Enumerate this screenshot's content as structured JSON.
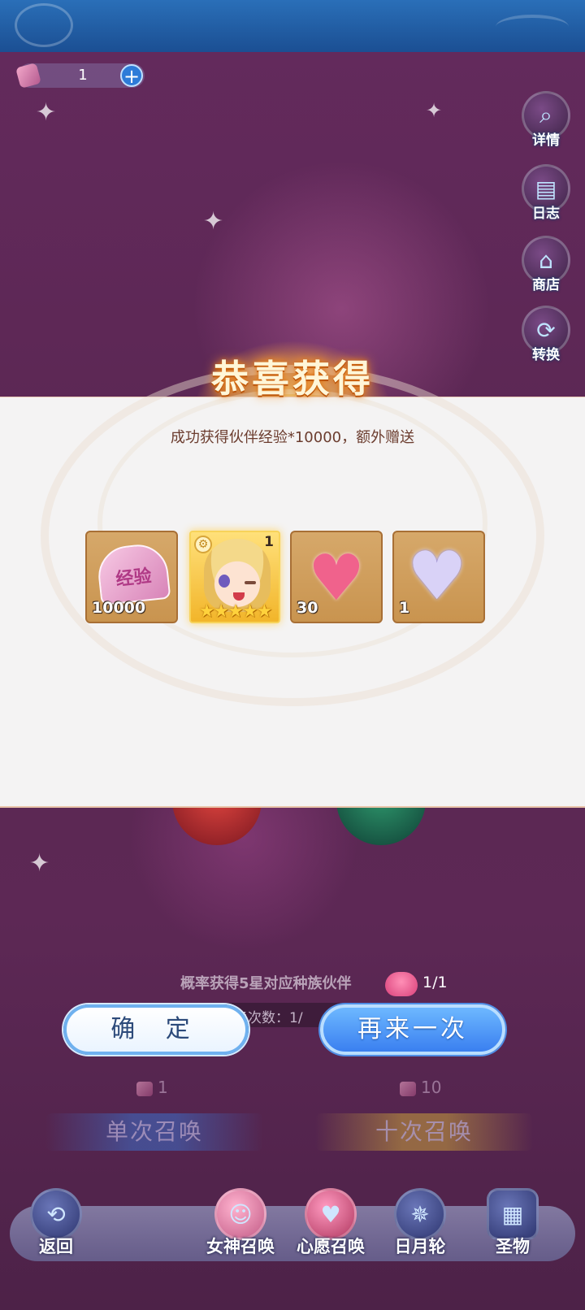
{
  "currency": {
    "value": "1",
    "plus_label": "+"
  },
  "side_menu": [
    {
      "label": "详情",
      "icon": "magnifier-icon",
      "glyph": "⌕"
    },
    {
      "label": "日志",
      "icon": "book-icon",
      "glyph": "▤"
    },
    {
      "label": "商店",
      "icon": "shop-icon",
      "glyph": "⌂"
    },
    {
      "label": "转换",
      "icon": "refresh-icon",
      "glyph": "⟳"
    }
  ],
  "reward_popup": {
    "title": "恭喜获得",
    "message": "成功获得伙伴经验*10000，额外赠送",
    "items": [
      {
        "name": "partner-exp-item",
        "count": "10000",
        "art_text": "经验"
      },
      {
        "name": "hero-card",
        "count": "1",
        "stars": "★★★★★"
      },
      {
        "name": "pink-heart-item",
        "count": "30"
      },
      {
        "name": "crystal-heart-item",
        "count": "1"
      }
    ]
  },
  "summon": {
    "probability_text": "概率获得5星对应种族伙伴",
    "wish_count": "1/1",
    "summon_count_text": "唤次数：1/",
    "single_cost": "1",
    "ten_cost": "10",
    "single_label": "单次召唤",
    "ten_label": "十次召唤"
  },
  "buttons": {
    "confirm": "确 定",
    "again": "再来一次"
  },
  "bottom_nav": {
    "back": "返回",
    "goddess_summon": "女神召唤",
    "wish_summon": "心愿召唤",
    "sun_moon_wheel": "日月轮",
    "relic": "圣物"
  },
  "colors": {
    "panel_bg": "#f4f3f3",
    "card_bg": "#d6a86a",
    "confirm_border": "#6fb1ef",
    "again_bg": "#3a7ff0",
    "title_glow": "#ff9c2a"
  }
}
